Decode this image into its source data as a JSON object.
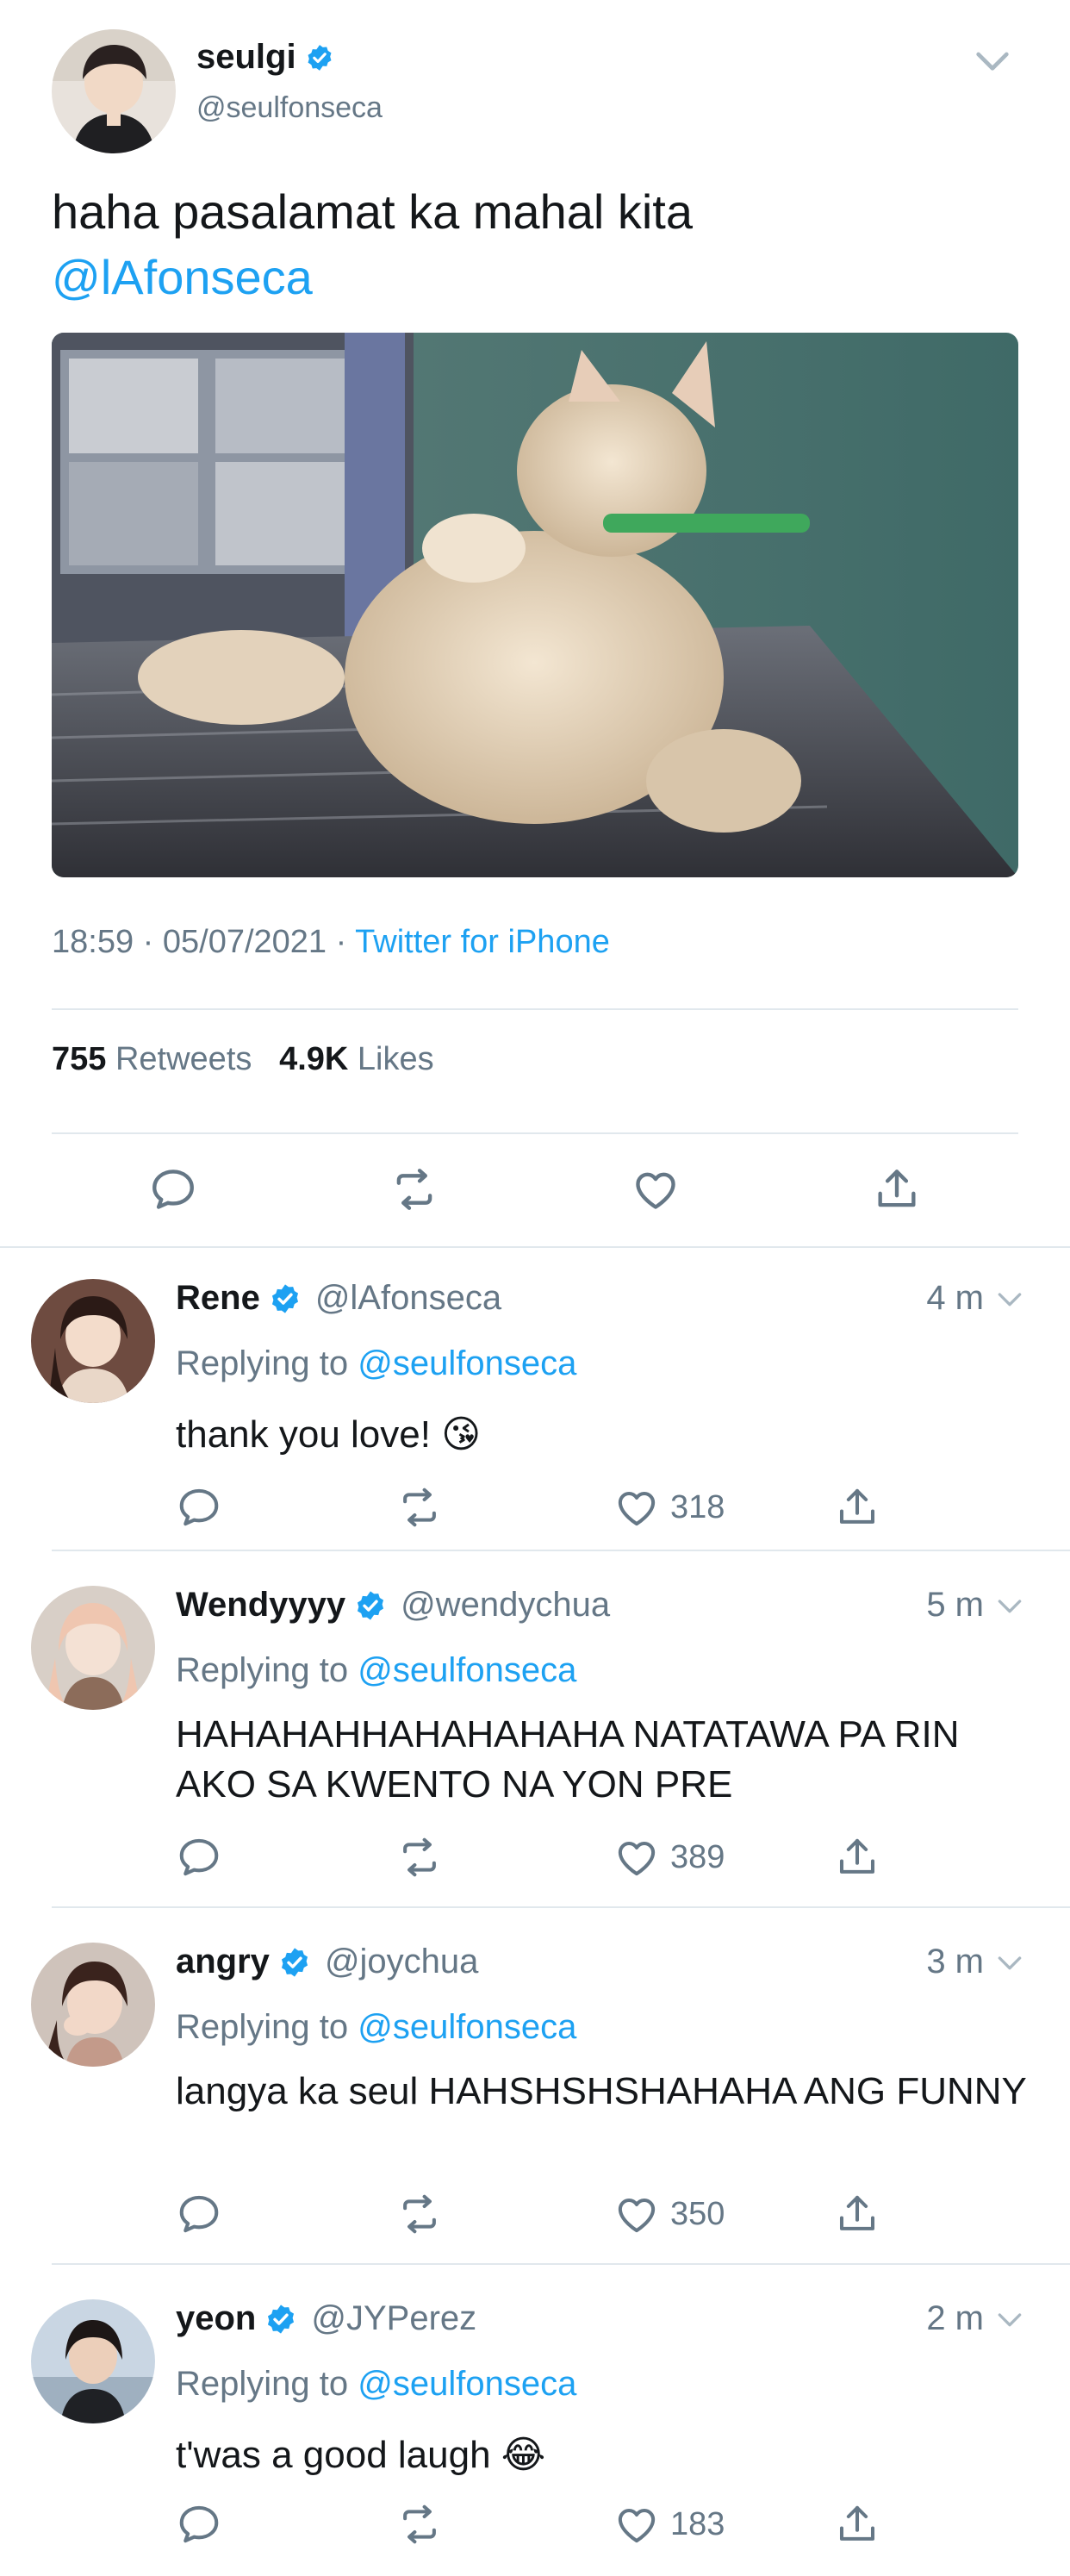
{
  "main_tweet": {
    "author_name": "seulgi",
    "author_handle": "@seulfonseca",
    "text": "haha pasalamat ka mahal kita",
    "mention": "@lAfonseca",
    "media_description_icon": "cat-photo",
    "time": "18:59",
    "date": "05/07/2021",
    "source": "Twitter for iPhone",
    "retweets_count": "755",
    "retweets_label": "Retweets",
    "likes_count": "4.9K",
    "likes_label": "Likes"
  },
  "replies": [
    {
      "name": "Rene",
      "handle": "@lAfonseca",
      "time": "4 m",
      "replying_label": "Replying to",
      "replying_to": "@seulfonseca",
      "text": "thank you love! 😘",
      "likes": "318"
    },
    {
      "name": "Wendyyyy",
      "handle": "@wendychua",
      "time": "5 m",
      "replying_label": "Replying to",
      "replying_to": "@seulfonseca",
      "text": "HAHAHAHHAHAHAHAHA NATATAWA PA RIN AKO SA KWENTO NA YON PRE",
      "likes": "389"
    },
    {
      "name": "angry",
      "handle": "@joychua",
      "time": "3 m",
      "replying_label": "Replying to",
      "replying_to": "@seulfonseca",
      "text": "langya ka seul HAHSHSHSHAHAHA ANG FUNNY",
      "likes": "350"
    },
    {
      "name": "yeon",
      "handle": "@JYPerez",
      "time": "2 m",
      "replying_label": "Replying to",
      "replying_to": "@seulfonseca",
      "text": "t'was a good laugh 😂",
      "likes": "183"
    }
  ],
  "colors": {
    "accent": "#1da1f2",
    "secondary_text": "#657786",
    "divider": "#e1e8ed",
    "primary_text": "#14171a"
  }
}
